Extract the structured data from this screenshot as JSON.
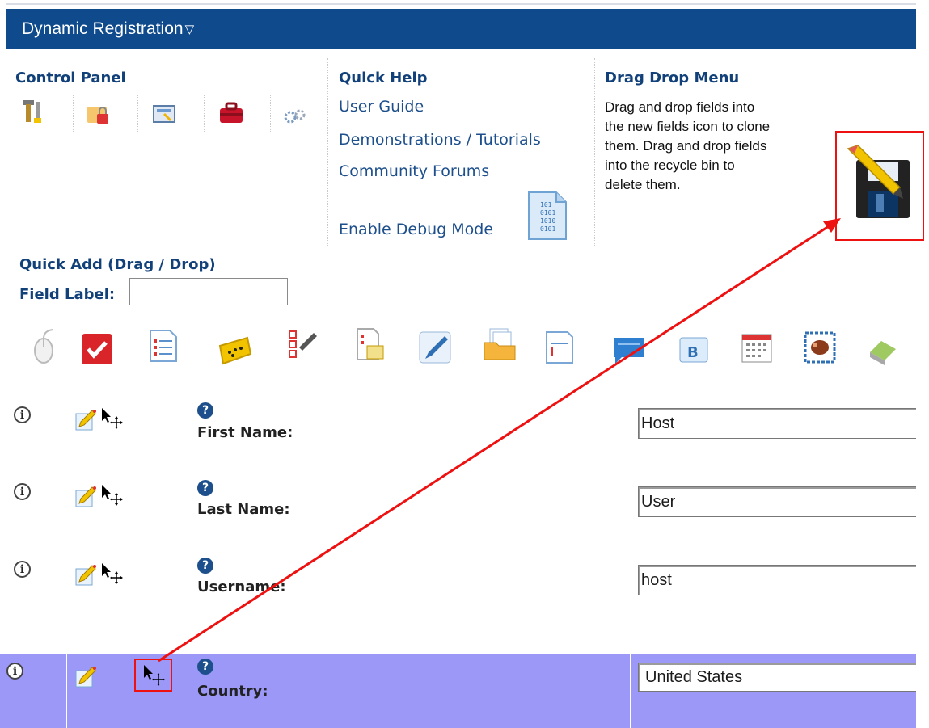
{
  "app": {
    "title": "Dynamic Registration"
  },
  "control_panel": {
    "header": "Control Panel",
    "icons": [
      "tools-icon",
      "user-lock-icon",
      "site-settings-icon",
      "toolbox-icon",
      "gears-icon"
    ]
  },
  "quick_help": {
    "header": "Quick Help",
    "links": {
      "user_guide": "User Guide",
      "demonstrations": "Demonstrations / Tutorials",
      "forums": "Community Forums",
      "debug": "Enable Debug Mode"
    }
  },
  "drag_drop_menu": {
    "header": "Drag Drop Menu",
    "lines": [
      "Drag and drop fields into",
      "the new fields icon to clone",
      "them. Drag and drop fields",
      "into the recycle bin to",
      "delete them."
    ]
  },
  "quick_add": {
    "header": "Quick Add (Drag / Drop)",
    "field_label": "Field Label:",
    "field_value": "",
    "tools": [
      "mouse-icon",
      "checkbox-icon",
      "numbered-list-icon",
      "rating-stars-icon",
      "checklist-pencil-icon",
      "checklist-doc-icon",
      "pencil-edit-icon",
      "folder-docs-icon",
      "text-doc-icon",
      "text-box-icon",
      "bold-text-icon",
      "calendar-icon",
      "image-stamp-icon",
      "eraser-icon"
    ]
  },
  "fields": [
    {
      "label": "First Name:",
      "value": "Host"
    },
    {
      "label": "Last Name:",
      "value": "User"
    },
    {
      "label": "Username:",
      "value": "host"
    },
    {
      "label": "Country:",
      "value": "United States"
    }
  ],
  "colors": {
    "title_bar": "#0f4a8c",
    "header_text": "#12417a",
    "highlight_row": "#9b98f8",
    "annotation": "#ee1111"
  }
}
